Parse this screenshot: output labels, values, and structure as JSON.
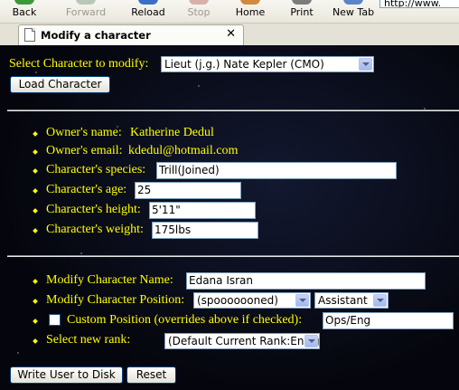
{
  "toolbar": {
    "back": "Back",
    "forward": "Forward",
    "reload": "Reload",
    "stop": "Stop",
    "home": "Home",
    "print": "Print",
    "new_tab": "New Tab",
    "url_partial": "http://www."
  },
  "tab": {
    "title": "Modify a character",
    "close": "✕"
  },
  "select_character": {
    "label": "Select Character to modify:",
    "selected": "Lieut (j.g.) Nate Kepler (CMO)",
    "load_button": "Load Character"
  },
  "info": {
    "owner_name_label": "Owner's name:",
    "owner_name": "Katherine Dedul",
    "owner_email_label": "Owner's email:",
    "owner_email": "kdedul@hotmail.com",
    "species_label": "Character's species:",
    "species": "Trill(Joined)",
    "age_label": "Character's age:",
    "age": "25",
    "height_label": "Character's height:",
    "height": "5'11\"",
    "weight_label": "Character's weight:",
    "weight": "175lbs"
  },
  "modify": {
    "name_label": "Modify Character Name:",
    "name": "Edana Isran",
    "position_label": "Modify Character Position:",
    "position_department": "(spooooooned)",
    "position_role": "Assistant",
    "custom_label": "Custom Position (overrides above if checked):",
    "custom_value": "Ops/Eng",
    "custom_checked": false,
    "rank_label": "Select new rank:",
    "rank_selected": "(Default Current Rank:Ensign"
  },
  "actions": {
    "write_button": "Write User to Disk",
    "reset_button": "Reset"
  },
  "colors": {
    "label_text": "#ffff00",
    "background": "#05060d",
    "control_border": "#7f9db9"
  }
}
